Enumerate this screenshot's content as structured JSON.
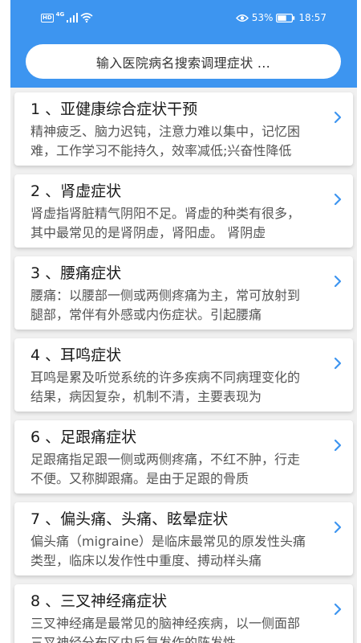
{
  "status": {
    "hd": "HD",
    "net": "4G",
    "battery_percent": "53%",
    "time": "18:57"
  },
  "search": {
    "placeholder": "输入医院病名搜索调理症状 ..."
  },
  "colors": {
    "header": "#3d95f0",
    "chevron": "#3d95f0"
  },
  "items": [
    {
      "title": "1 、亚健康综合症状干预",
      "desc": "精神疲乏、脑力迟钝，注意力难以集中，记忆困难，工作学习不能持久，效率减低;兴奋性降低"
    },
    {
      "title": "2 、肾虚症状",
      "desc": "肾虚指肾脏精气阴阳不足。肾虚的种类有很多，其中最常见的是肾阴虚，肾阳虚。 肾阴虚"
    },
    {
      "title": "3 、腰痛症状",
      "desc": "腰痛：以腰部一侧或两侧疼痛为主，常可放射到腿部，常伴有外感或内伤症状。引起腰痛"
    },
    {
      "title": "4 、耳鸣症状",
      "desc": "耳鸣是累及听觉系统的许多疾病不同病理变化的结果，病因复杂，机制不清，主要表现为"
    },
    {
      "title": "6 、足跟痛症状",
      "desc": "足跟痛指足跟一侧或两侧疼痛，不红不肿，行走不便。又称脚跟痛。是由于足跟的骨质"
    },
    {
      "title": "7 、偏头痛、头痛、眩晕症状",
      "desc": "偏头痛（migraine）是临床最常见的原发性头痛类型，临床以发作性中重度、搏动样头痛"
    },
    {
      "title": "8 、三叉神经痛症状",
      "desc": "三叉神经痛是最常见的脑神经疾病，以一侧面部三叉神经分布区内反复发作的阵发性"
    }
  ]
}
